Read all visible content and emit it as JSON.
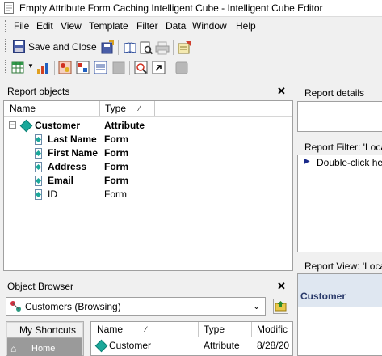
{
  "window": {
    "title": "Empty Attribute Form Caching Intelligent Cube - Intelligent Cube Editor"
  },
  "menu": [
    "File",
    "Edit",
    "View",
    "Template",
    "Filter",
    "Data",
    "Window",
    "Help"
  ],
  "toolbar": {
    "save_and_close_label": "Save and Close"
  },
  "report_objects": {
    "title": "Report objects",
    "columns": [
      "Name",
      "Type"
    ],
    "rows": [
      {
        "name": "Customer",
        "type": "Attribute"
      },
      {
        "name": "Last Name",
        "type": "Form"
      },
      {
        "name": "First Name",
        "type": "Form"
      },
      {
        "name": "Address",
        "type": "Form"
      },
      {
        "name": "Email",
        "type": "Form"
      },
      {
        "name": "ID",
        "type": "Form"
      }
    ]
  },
  "report_details": {
    "title": "Report details"
  },
  "report_filter": {
    "title": "Report Filter: 'Local",
    "hint": "Double-click he"
  },
  "report_view": {
    "title": "Report View: 'Local",
    "row_header": "Customer"
  },
  "object_browser": {
    "title": "Object Browser",
    "location": "Customers (Browsing)",
    "shortcuts_label": "My Shortcuts",
    "home_label": "Home",
    "columns": [
      "Name",
      "Type",
      "Modific"
    ],
    "rows": [
      {
        "name": "Customer",
        "type": "Attribute",
        "modified": "8/28/20"
      }
    ]
  }
}
